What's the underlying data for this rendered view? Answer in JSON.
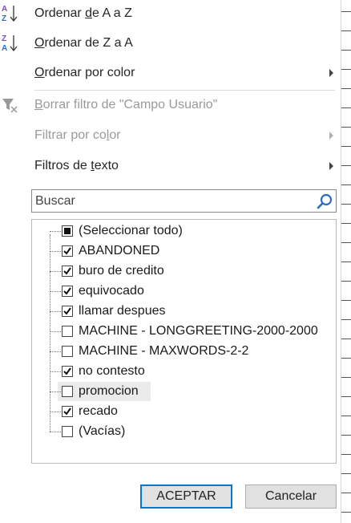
{
  "menu": {
    "sort_az": {
      "pre": "Ordenar ",
      "mn": "d",
      "post": "e A a Z"
    },
    "sort_za": {
      "pre": "",
      "mn": "O",
      "post": "rdenar de Z a A"
    },
    "sort_by_color": {
      "pre": "",
      "mn": "O",
      "post": "rdenar por color"
    },
    "clear_filter": {
      "pre": "",
      "mn": "B",
      "post": "orrar filtro de \"Campo Usuario\""
    },
    "filter_by_color": {
      "pre": "Filtrar por co",
      "mn": "l",
      "post": "or"
    },
    "text_filters": {
      "pre": "Filtros de ",
      "mn": "t",
      "post": "exto"
    }
  },
  "icons": {
    "sort_az": "sort-ascending-icon",
    "sort_za": "sort-descending-icon",
    "clear_filter": "clear-filter-icon",
    "search": "search-icon",
    "submenu": "chevron-right-icon",
    "accent": "#7b4fb0",
    "focus": "#0078d7"
  },
  "search": {
    "placeholder": "Buscar",
    "value": ""
  },
  "filter_list": [
    {
      "label": "(Seleccionar todo)",
      "state": "partial"
    },
    {
      "label": "ABANDONED",
      "state": "checked"
    },
    {
      "label": "buro de credito",
      "state": "checked"
    },
    {
      "label": "equivocado",
      "state": "checked"
    },
    {
      "label": "llamar despues",
      "state": "checked"
    },
    {
      "label": "MACHINE - LONGGREETING-2000-2000",
      "state": "unchecked"
    },
    {
      "label": "MACHINE - MAXWORDS-2-2",
      "state": "unchecked"
    },
    {
      "label": "no contesto",
      "state": "checked"
    },
    {
      "label": "promocion",
      "state": "unchecked",
      "hovered": true
    },
    {
      "label": "recado",
      "state": "checked"
    },
    {
      "label": "(Vacías)",
      "state": "unchecked"
    }
  ],
  "buttons": {
    "ok": "ACEPTAR",
    "cancel": "Cancelar"
  }
}
